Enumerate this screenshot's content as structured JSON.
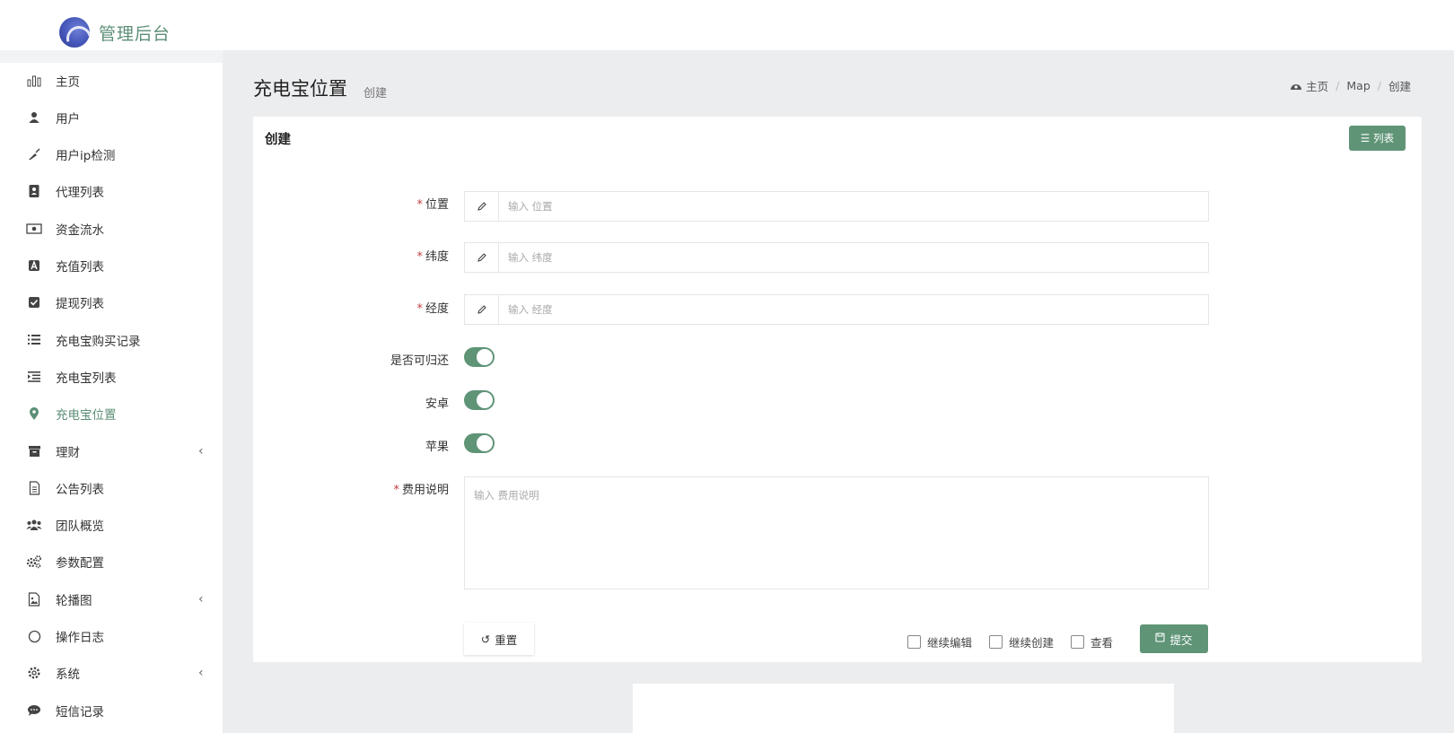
{
  "app": {
    "title": "管理后台"
  },
  "colors": {
    "accent": "#5f9477",
    "accent_text": "#5c8e76",
    "required": "#c04040"
  },
  "sidebar": {
    "items": [
      {
        "label": "主页",
        "icon": "bar-chart-icon",
        "active": false,
        "expandable": false
      },
      {
        "label": "用户",
        "icon": "user-icon",
        "active": false,
        "expandable": false
      },
      {
        "label": "用户ip检测",
        "icon": "broom-icon",
        "active": false,
        "expandable": false
      },
      {
        "label": "代理列表",
        "icon": "contact-book-icon",
        "active": false,
        "expandable": false
      },
      {
        "label": "资金流水",
        "icon": "money-icon",
        "active": false,
        "expandable": false
      },
      {
        "label": "充值列表",
        "icon": "letter-a-icon",
        "active": false,
        "expandable": false
      },
      {
        "label": "提现列表",
        "icon": "check-square-icon",
        "active": false,
        "expandable": false
      },
      {
        "label": "充电宝购买记录",
        "icon": "list-icon",
        "active": false,
        "expandable": false
      },
      {
        "label": "充电宝列表",
        "icon": "indent-list-icon",
        "active": false,
        "expandable": false
      },
      {
        "label": "充电宝位置",
        "icon": "map-pin-icon",
        "active": true,
        "expandable": false
      },
      {
        "label": "理财",
        "icon": "archive-icon",
        "active": false,
        "expandable": true
      },
      {
        "label": "公告列表",
        "icon": "document-icon",
        "active": false,
        "expandable": false
      },
      {
        "label": "团队概览",
        "icon": "users-icon",
        "active": false,
        "expandable": false
      },
      {
        "label": "参数配置",
        "icon": "cogs-icon",
        "active": false,
        "expandable": false
      },
      {
        "label": "轮播图",
        "icon": "image-icon",
        "active": false,
        "expandable": true
      },
      {
        "label": "操作日志",
        "icon": "circle-icon",
        "active": false,
        "expandable": false
      },
      {
        "label": "系统",
        "icon": "gear-icon",
        "active": false,
        "expandable": true
      },
      {
        "label": "短信记录",
        "icon": "chat-icon",
        "active": false,
        "expandable": false
      }
    ]
  },
  "header": {
    "title": "充电宝位置",
    "subtitle": "创建",
    "breadcrumb": [
      "主页",
      "Map",
      "创建"
    ]
  },
  "card": {
    "title": "创建",
    "list_button": "列表"
  },
  "form": {
    "location": {
      "label": "位置",
      "required": true,
      "placeholder": "输入 位置",
      "value": ""
    },
    "latitude": {
      "label": "纬度",
      "required": true,
      "placeholder": "输入 纬度",
      "value": ""
    },
    "longitude": {
      "label": "经度",
      "required": true,
      "placeholder": "输入 经度",
      "value": ""
    },
    "returnable": {
      "label": "是否可归还",
      "on": true
    },
    "android": {
      "label": "安卓",
      "on": true
    },
    "apple": {
      "label": "苹果",
      "on": true
    },
    "fee_desc": {
      "label": "费用说明",
      "required": true,
      "placeholder": "输入 费用说明",
      "value": ""
    }
  },
  "footer": {
    "reset": "重置",
    "continue_edit": "继续编辑",
    "continue_create": "继续创建",
    "view": "查看",
    "submit": "提交"
  }
}
